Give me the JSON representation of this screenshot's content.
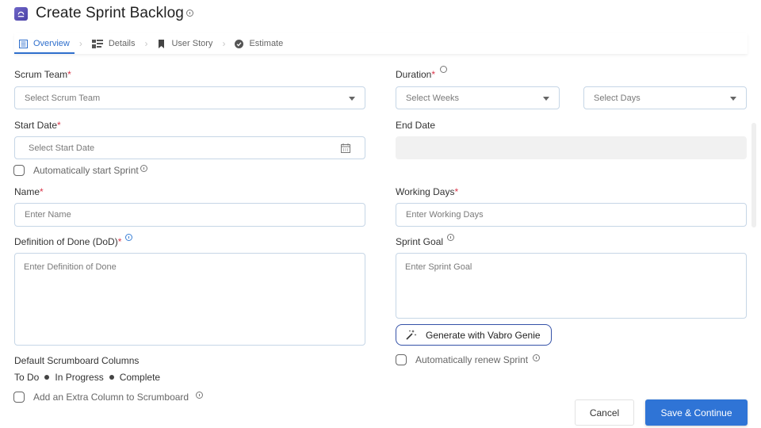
{
  "header": {
    "title": "Create Sprint Backlog",
    "icon": "sprint-backlog-icon"
  },
  "tabs": [
    {
      "label": "Overview",
      "icon": "list-icon",
      "active": true
    },
    {
      "label": "Details",
      "icon": "details-icon",
      "active": false
    },
    {
      "label": "User Story",
      "icon": "bookmark-icon",
      "active": false
    },
    {
      "label": "Estimate",
      "icon": "check-circle-icon",
      "active": false
    }
  ],
  "form": {
    "scrum_team": {
      "label": "Scrum Team",
      "required": "*",
      "placeholder": "Select Scrum Team"
    },
    "duration": {
      "label": "Duration",
      "required": "*",
      "weeks_placeholder": "Select Weeks",
      "days_placeholder": "Select Days"
    },
    "start_date": {
      "label": "Start Date",
      "required": "*",
      "placeholder": "Select Start Date"
    },
    "end_date": {
      "label": "End Date",
      "value": ""
    },
    "auto_start": {
      "label": "Automatically start Sprint",
      "checked": false
    },
    "name": {
      "label": "Name",
      "required": "*",
      "placeholder": "Enter Name"
    },
    "working_days": {
      "label": "Working Days",
      "required": "*",
      "placeholder": "Enter Working Days"
    },
    "dod": {
      "label": "Definition of Done (DoD)",
      "required": "*",
      "placeholder": "Enter Definition of Done"
    },
    "sprint_goal": {
      "label": "Sprint Goal",
      "placeholder": "Enter Sprint Goal"
    },
    "genie_button": "Generate with Vabro Genie",
    "auto_renew": {
      "label": "Automatically renew Sprint",
      "checked": false
    },
    "scrumboard": {
      "label": "Default Scrumboard Columns",
      "columns": [
        "To Do",
        "In Progress",
        "Complete"
      ]
    },
    "extra_column": {
      "label": "Add an Extra Column to Scrumboard",
      "checked": false
    }
  },
  "actions": {
    "cancel": "Cancel",
    "save": "Save & Continue"
  },
  "colors": {
    "accent": "#2f74d6",
    "required": "#d9364a",
    "genie_border": "#3552a8"
  }
}
